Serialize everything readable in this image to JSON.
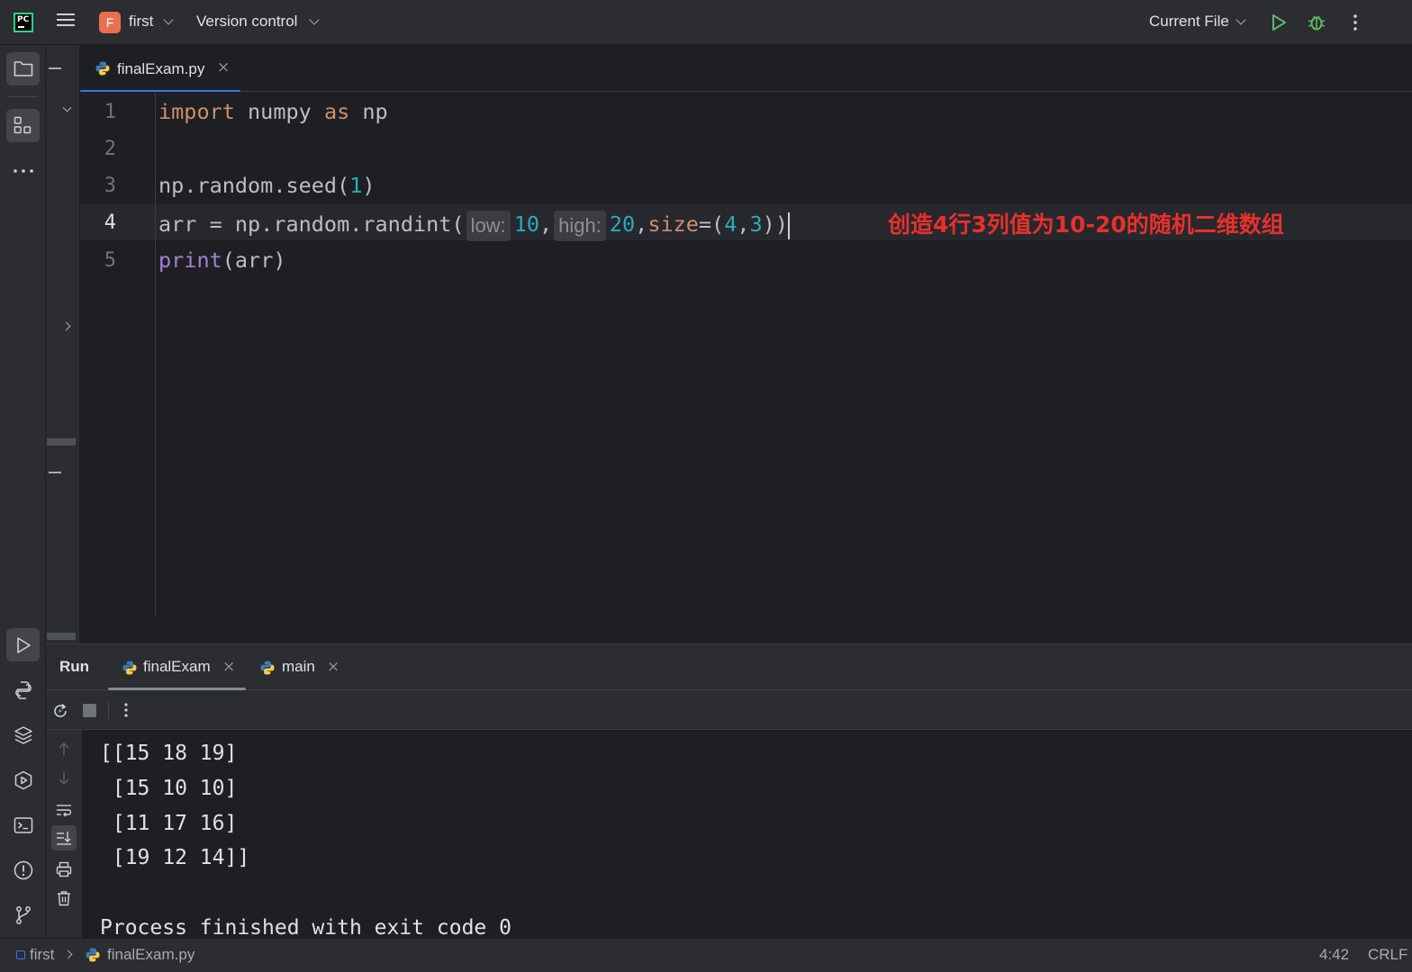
{
  "window": {
    "project_badge": "F",
    "project_name": "first",
    "vcs_label": "Version control",
    "run_config": "Current File"
  },
  "editor": {
    "tab_label": "finalExam.py",
    "line_numbers": [
      "1",
      "2",
      "3",
      "4",
      "5"
    ],
    "lines": {
      "l1": {
        "import": "import",
        "module": " numpy ",
        "as": "as",
        "alias": " np"
      },
      "l3": {
        "pre": "np.random.seed(",
        "num": "1",
        "post": ")"
      },
      "l4": {
        "pre": "arr = np.random.randint(",
        "hint_low": "low:",
        "low": "10",
        "comma1": ",",
        "hint_high": "high:",
        "high": "20",
        "comma2": ",",
        "param": "size",
        "eq": "=(",
        "a": "4",
        "comma3": ",",
        "b": "3",
        "end": "))"
      },
      "l5": {
        "fn": "print",
        "rest": "(arr)"
      }
    },
    "annotation": "创造4行3列值为10-20的随机二维数组"
  },
  "run_panel": {
    "title": "Run",
    "tabs": [
      "finalExam",
      "main"
    ],
    "output": [
      "[[15 18 19]",
      " [15 10 10]",
      " [11 17 16]",
      " [19 12 14]]",
      "",
      "Process finished with exit code 0"
    ]
  },
  "status": {
    "breadcrumb_project": "first",
    "breadcrumb_file": "finalExam.py",
    "position": "4:42",
    "line_ending": "CRLF"
  },
  "colors": {
    "accent": "#3574f0",
    "keyword": "#cf8e6d",
    "number": "#2aacb8",
    "function": "#a281d4",
    "annotation": "#e8302b",
    "run_green": "#5fb865"
  }
}
